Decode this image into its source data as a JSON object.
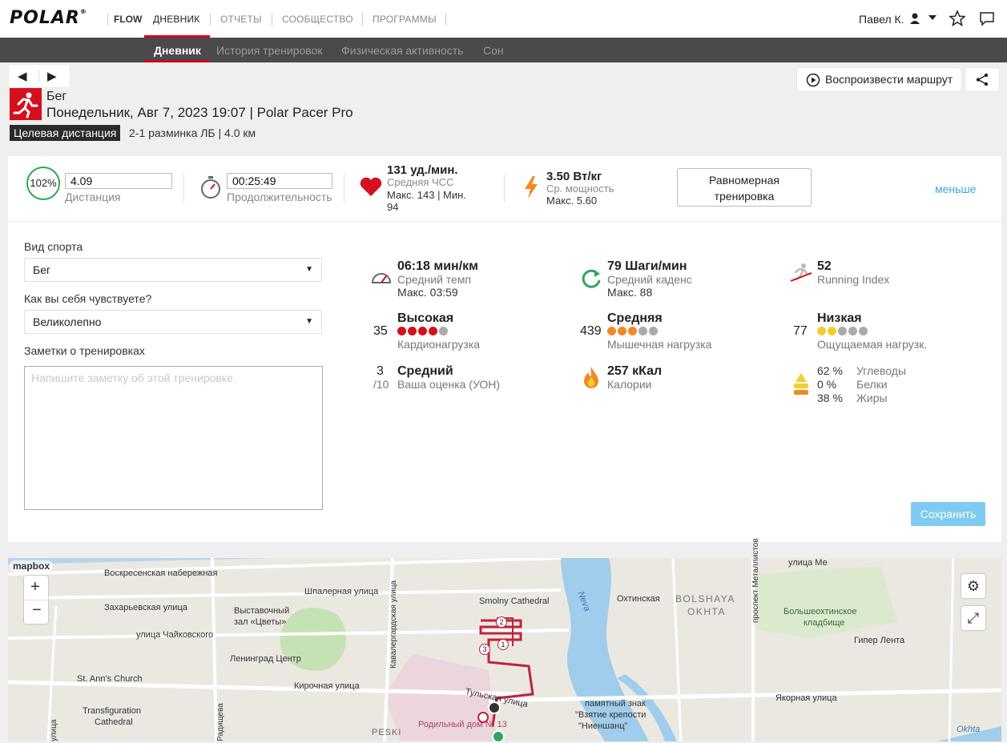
{
  "brand": {
    "logo": "POLAR",
    "reg": "®",
    "product": "FLOW"
  },
  "topnav": {
    "items": [
      "ДНЕВНИК",
      "ОТЧЕТЫ",
      "СООБЩЕСТВО",
      "ПРОГРАММЫ"
    ],
    "active": "ДНЕВНИК",
    "user": "Павел К."
  },
  "subnav": {
    "items": [
      "Дневник",
      "История тренировок",
      "Физическая активность",
      "Сон"
    ],
    "active": "Дневник"
  },
  "header": {
    "replay_label": "Воспроизвести маршрут",
    "sport": "Бег",
    "date_device": "Понедельник, Авг 7, 2023 19:07 | Polar Pacer Pro",
    "target_badge": "Целевая дистанция",
    "target_text": "2-1 разминка ЛБ  | 4.0 км"
  },
  "summary": {
    "ring": "102%",
    "distance": {
      "value": "4.09",
      "label": "Дистанция"
    },
    "duration": {
      "value": "00:25:49",
      "label": "Продолжительность"
    },
    "hr": {
      "value": "131 уд./мин.",
      "label": "Средняя ЧСС",
      "max_min": "Макс. 143  |  Мин.",
      "min_value": "94"
    },
    "power": {
      "value": "3.50 Вт/кг",
      "label": "Ср. мощность",
      "max": "Макс. 5.60"
    },
    "uniform_line1": "Равномерная",
    "uniform_line2": "тренировка",
    "less": "меньше"
  },
  "form": {
    "sport_label": "Вид спорта",
    "sport_value": "Бег",
    "feeling_label": "Как вы себя чувствуете?",
    "feeling_value": "Великолепно",
    "notes_label": "Заметки о тренировках",
    "notes_placeholder": "Напишите заметку об этой тренировке.",
    "save": "Сохранить"
  },
  "stats": {
    "pace": {
      "value": "06:18 мин/км",
      "label": "Средний темп",
      "max": "Макс. 03:59"
    },
    "cadence": {
      "value": "79 Шаги/мин",
      "label": "Средний каденс",
      "max": "Макс. 88"
    },
    "running_index": {
      "value": "52",
      "label": "Running Index"
    },
    "cardio": {
      "num": "35",
      "level": "Высокая",
      "label": "Кардионагрузка",
      "filled": 4,
      "total": 5,
      "color": "#d4101e"
    },
    "muscle": {
      "num": "439",
      "level": "Средняя",
      "label": "Мышечная нагрузка",
      "filled": 3,
      "total": 5,
      "color": "#f08a24"
    },
    "perceived": {
      "num": "77",
      "level": "Низкая",
      "label": "Ощущаемая нагрузк.",
      "filled": 2,
      "total": 5,
      "color": "#f3cf2c"
    },
    "rpe": {
      "num": "3",
      "den": "/10",
      "level": "Средний",
      "label": "Ваша оценка (УОН)"
    },
    "calories": {
      "value": "257 кКал",
      "label": "Калории"
    },
    "fuel": {
      "carbs_pct": "62 %",
      "carbs": "Углеводы",
      "protein_pct": "0 %",
      "protein": "Белки",
      "fat_pct": "38 %",
      "fat": "Жиры"
    }
  },
  "map": {
    "attribution": "mapbox",
    "labels": [
      "Воскресенская набережная",
      "Шпалерная улица",
      "Захарьевская улица",
      "Выставочный",
      "зал «Цветы»",
      "улица Чайковского",
      "Ленинград Центр",
      "St. Ann's Church",
      "Кирочная улица",
      "Transfiguration",
      "Cathedral",
      "Smolny Cathedral",
      "Кавалергардская улица",
      "Тульская улица",
      "Родильный дом № 13",
      "PESKI",
      "Охтинская",
      "BOLSHAYA",
      "OKHTA",
      "проспект Металлистов",
      "Большеохтинское",
      "кладбище",
      "Гипер Лента",
      "памятный знак",
      "\"Взятие крепости",
      "\"Ниеншанц\"",
      "Якорная улица",
      "Neva",
      "Okhta",
      "улица Ме",
      "Радищева",
      "улица",
      "1",
      "2",
      "3"
    ]
  }
}
